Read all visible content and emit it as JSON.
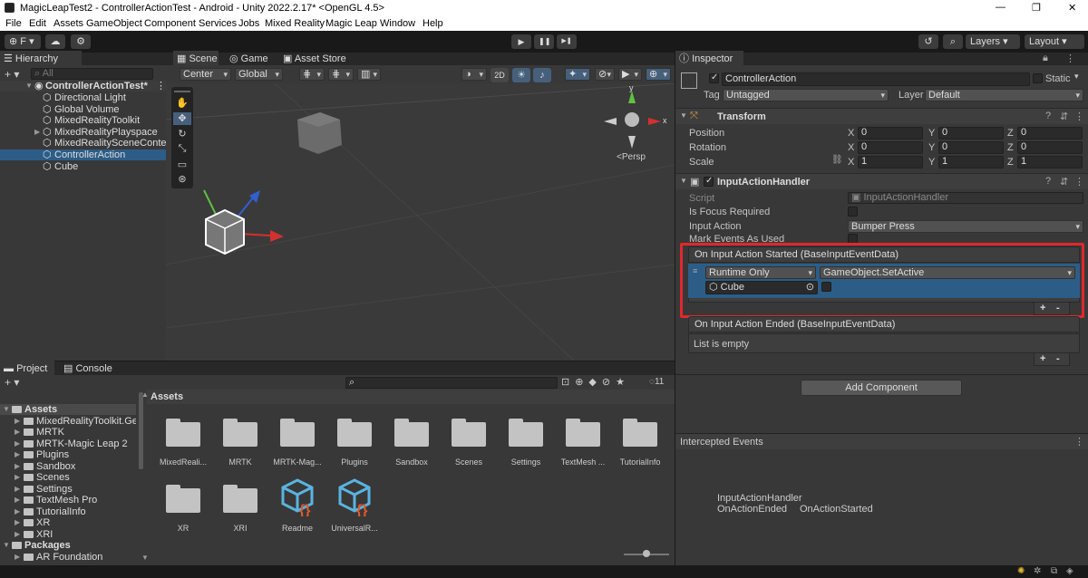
{
  "window": {
    "title": "MagicLeapTest2 - ControllerActionTest - Android - Unity 2022.2.17* <OpenGL 4.5>",
    "minimize": "—",
    "maximize": "❐",
    "close": "✕"
  },
  "menu": [
    "File",
    "Edit",
    "Assets",
    "GameObject",
    "Component",
    "Services",
    "Jobs",
    "Mixed Reality",
    "Magic Leap",
    "Window",
    "Help"
  ],
  "toolbar": {
    "account": "F",
    "layers": "Layers",
    "layout": "Layout",
    "play": "▶",
    "pause": "❚❚",
    "step": "▶❚"
  },
  "hierarchy": {
    "tab": "Hierarchy",
    "search_placeholder": "All",
    "scene": "ControllerActionTest*",
    "items": [
      "Directional Light",
      "Global Volume",
      "MixedRealityToolkit",
      "MixedRealityPlayspace",
      "MixedRealitySceneConten",
      "ControllerAction",
      "Cube"
    ],
    "selected_index": 5
  },
  "scene_tabs": {
    "scene": "Scene",
    "game": "Game",
    "asset_store": "Asset Store"
  },
  "scene_toolbar": {
    "pivot": "Center",
    "space": "Global",
    "mode_2d": "2D",
    "persp": "<Persp"
  },
  "project": {
    "tab_project": "Project",
    "tab_console": "Console",
    "hidden_count": "11",
    "breadcrumb": "Assets",
    "tree": [
      {
        "label": "Assets",
        "depth": 0,
        "expanded": true
      },
      {
        "label": "MixedRealityToolkit.Gene",
        "depth": 1
      },
      {
        "label": "MRTK",
        "depth": 1
      },
      {
        "label": "MRTK-Magic Leap 2",
        "depth": 1
      },
      {
        "label": "Plugins",
        "depth": 1
      },
      {
        "label": "Sandbox",
        "depth": 1
      },
      {
        "label": "Scenes",
        "depth": 1
      },
      {
        "label": "Settings",
        "depth": 1
      },
      {
        "label": "TextMesh Pro",
        "depth": 1
      },
      {
        "label": "TutorialInfo",
        "depth": 1
      },
      {
        "label": "XR",
        "depth": 1
      },
      {
        "label": "XRI",
        "depth": 1
      },
      {
        "label": "Packages",
        "depth": 0,
        "expanded": true
      },
      {
        "label": "AR Foundation",
        "depth": 1
      }
    ],
    "assets": [
      {
        "name": "MixedReali...",
        "kind": "folder"
      },
      {
        "name": "MRTK",
        "kind": "folder"
      },
      {
        "name": "MRTK-Mag...",
        "kind": "folder"
      },
      {
        "name": "Plugins",
        "kind": "folder"
      },
      {
        "name": "Sandbox",
        "kind": "folder"
      },
      {
        "name": "Scenes",
        "kind": "folder"
      },
      {
        "name": "Settings",
        "kind": "folder"
      },
      {
        "name": "TextMesh ...",
        "kind": "folder"
      },
      {
        "name": "TutorialInfo",
        "kind": "folder"
      },
      {
        "name": "XR",
        "kind": "folder"
      },
      {
        "name": "XRI",
        "kind": "folder"
      },
      {
        "name": "Readme",
        "kind": "script-asset"
      },
      {
        "name": "UniversalR...",
        "kind": "script-asset"
      }
    ]
  },
  "inspector": {
    "tab": "Inspector",
    "object_name": "ControllerAction",
    "static_label": "Static",
    "tag_label": "Tag",
    "tag_value": "Untagged",
    "layer_label": "Layer",
    "layer_value": "Default",
    "transform": {
      "title": "Transform",
      "rows": [
        {
          "label": "Position",
          "x": "0",
          "y": "0",
          "z": "0"
        },
        {
          "label": "Rotation",
          "x": "0",
          "y": "0",
          "z": "0"
        },
        {
          "label": "Scale",
          "x": "1",
          "y": "1",
          "z": "1"
        }
      ],
      "x": "X",
      "y": "Y",
      "z": "Z"
    },
    "handler": {
      "title": "InputActionHandler",
      "script_label": "Script",
      "script_value": "InputActionHandler",
      "focus_label": "Is Focus Required",
      "action_label": "Input Action",
      "action_value": "Bumper Press",
      "mark_label": "Mark Events As Used",
      "started": {
        "title": "On Input Action Started (BaseInputEventData)",
        "runtime": "Runtime Only",
        "function": "GameObject.SetActive",
        "target": "Cube"
      },
      "ended": {
        "title": "On Input Action Ended (BaseInputEventData)",
        "empty": "List is empty"
      },
      "plus": "+",
      "minus": "-"
    },
    "add_component": "Add Component",
    "intercepted": {
      "title": "Intercepted Events",
      "handler": "InputActionHandler",
      "events": [
        "OnActionEnded",
        "OnActionStarted"
      ]
    }
  },
  "colors": {
    "highlight_box": "#e0282e",
    "selection": "#2c5d87",
    "panel": "#383838"
  }
}
